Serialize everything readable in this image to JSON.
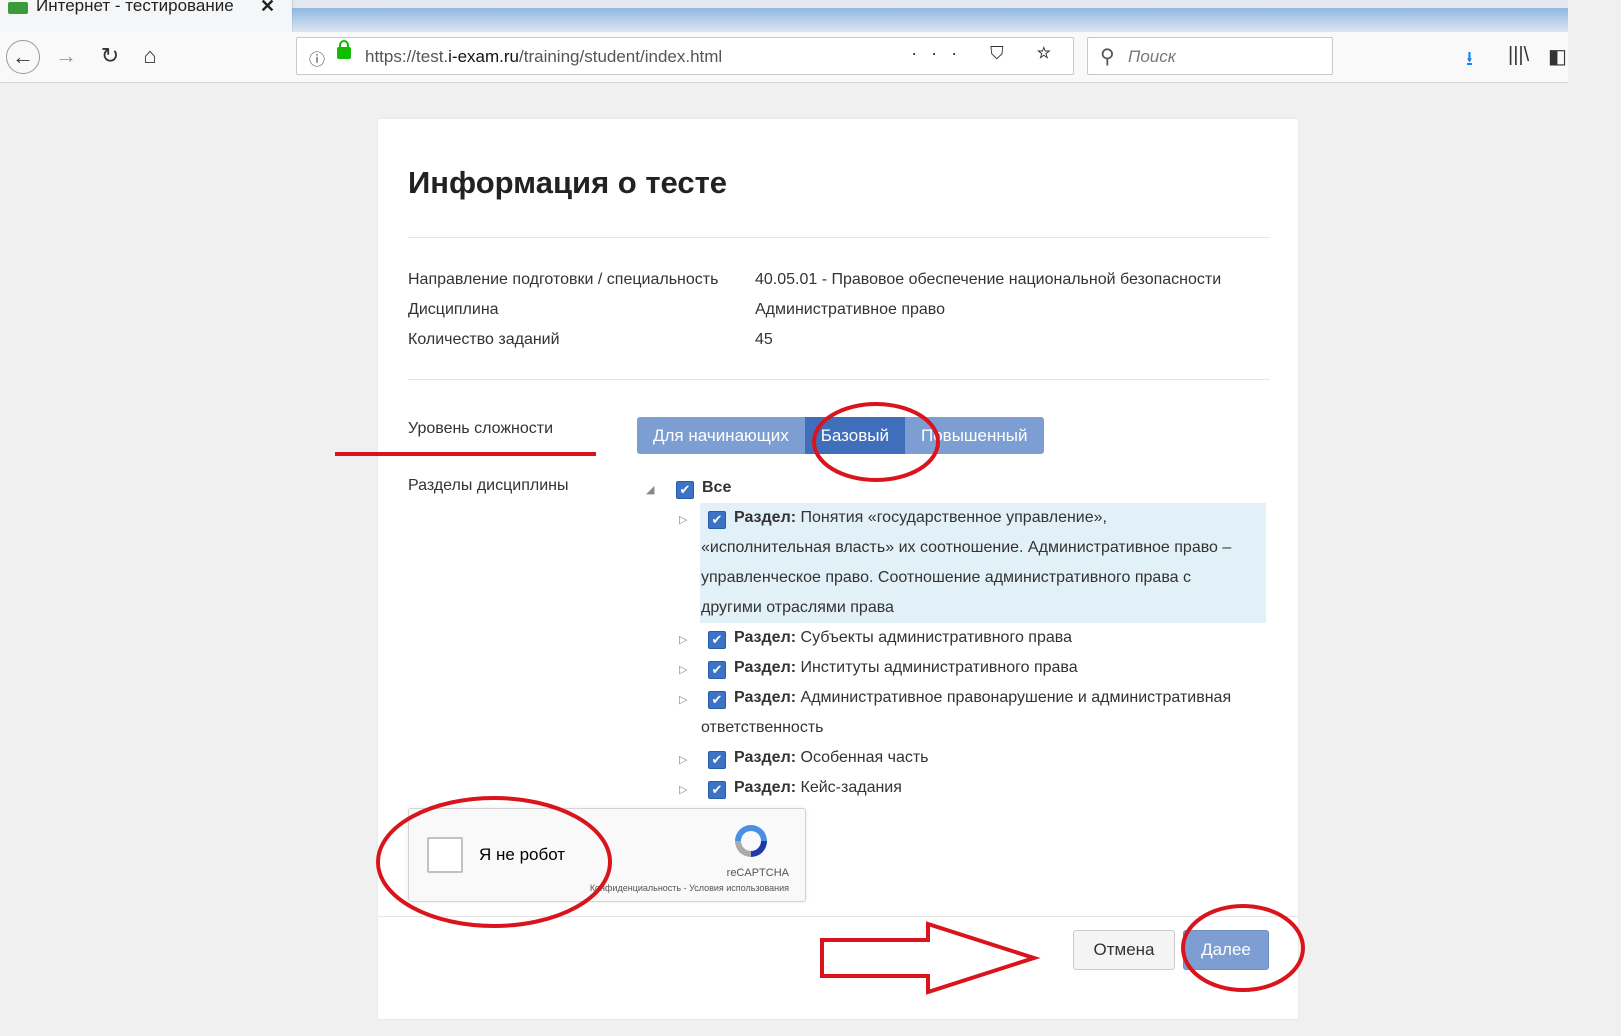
{
  "browser": {
    "tab_title": "Интернет - тестирование",
    "tab_close": "✕",
    "url_info": "ⓘ",
    "url_prefix": "https://test.",
    "url_domain": "i-exam.ru",
    "url_path": "/training/student/index.html",
    "url_actions": "··· ⛉ ☆",
    "search_placeholder": "Поиск",
    "back_icon": "←",
    "forward_icon": "→",
    "reload_icon": "↻",
    "home_icon": "⌂",
    "download_icon": "⭳",
    "library_icon": "|||\\",
    "sidebar_icon": "◧"
  },
  "page": {
    "title": "Информация о тесте",
    "info": [
      {
        "label": "Направление подготовки / специальность",
        "value": "40.05.01 - Правовое обеспечение национальной безопасности"
      },
      {
        "label": "Дисциплина",
        "value": "Административное право"
      },
      {
        "label": "Количество заданий",
        "value": "45"
      }
    ],
    "difficulty_label": "Уровень сложности",
    "difficulty_options": [
      "Для начинающих",
      "Базовый",
      "Повышенный"
    ],
    "difficulty_selected": "Базовый",
    "sections_label": "Разделы дисциплины",
    "tree": {
      "root_toggle": "◢",
      "child_toggle": "▷",
      "check_mark": "✔",
      "root_label": "Все",
      "section_prefix": "Раздел:",
      "sections": [
        {
          "lines": [
            "Понятия «государственное управление»,",
            "«исполнительная власть» их соотношение. Административное право –",
            "управленческое право. Соотношение административного права с",
            "другими отраслями права"
          ]
        },
        {
          "lines": [
            "Субъекты административного права"
          ]
        },
        {
          "lines": [
            "Институты административного права"
          ]
        },
        {
          "lines": [
            "Административное правонарушение и административная",
            "ответственность"
          ]
        },
        {
          "lines": [
            "Особенная часть"
          ]
        },
        {
          "lines": [
            "Кейс-задания"
          ]
        }
      ]
    },
    "recaptcha": {
      "label": "Я не робот",
      "brand": "reCAPTCHA",
      "links": "Конфиденциальность - Условия использования"
    },
    "cancel_label": "Отмена",
    "next_label": "Далее"
  },
  "colors": {
    "annotation": "#d9141c",
    "segment": "#7d9ed3",
    "segment_active": "#3f6fba",
    "highlight": "#e2f0f8"
  }
}
